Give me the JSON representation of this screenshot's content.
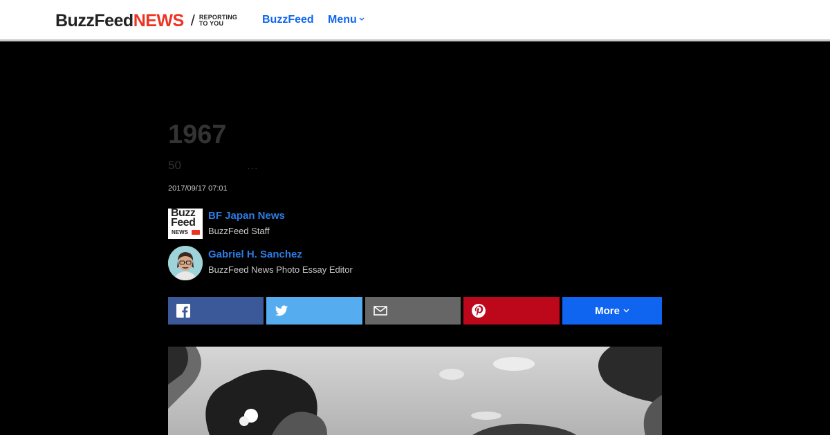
{
  "header": {
    "logo_buzzfeed": "BuzzFeed",
    "logo_news": "NEWS",
    "logo_slash": "/",
    "tagline_line1": "REPORTING",
    "tagline_line2": "TO YOU",
    "nav_buzzfeed": "BuzzFeed",
    "nav_menu": "Menu"
  },
  "article": {
    "title": "1967",
    "subtitle": "50                    …",
    "timestamp": "2017/09/17 07:01",
    "bylines": [
      {
        "name": "BF Japan News",
        "role": "BuzzFeed Staff",
        "avatar_lines": [
          "Buzz",
          "Feed",
          "NEWS"
        ]
      },
      {
        "name": "Gabriel H. Sanchez",
        "role": "BuzzFeed News Photo Essay Editor"
      }
    ]
  },
  "share": {
    "facebook_icon": "facebook-icon",
    "twitter_icon": "twitter-icon",
    "email_icon": "email-icon",
    "pinterest_icon": "pinterest-icon",
    "more_label": "More"
  },
  "colors": {
    "brand_red": "#ee3322",
    "link_blue": "#0f65ef",
    "facebook": "#3b5998",
    "twitter": "#55acee",
    "email": "#666666",
    "pinterest": "#bd081c"
  }
}
